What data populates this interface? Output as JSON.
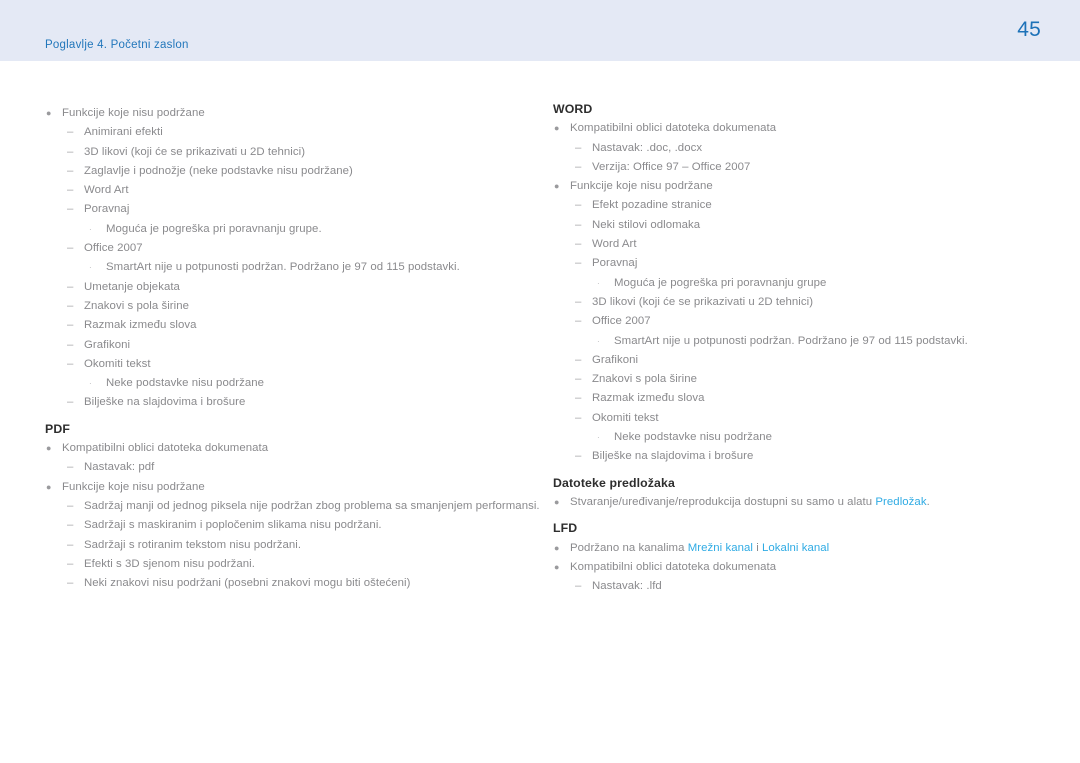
{
  "header": {
    "chapter": "Poglavlje 4. Početni zaslon",
    "page_number": "45",
    "band_color": "#e4e9f5",
    "text_color": "#2277bb"
  },
  "colors": {
    "link": "#2fabe4",
    "body_text": "#8a8a8d",
    "heading_text": "#2e2e2e"
  },
  "left_column": {
    "blocks": [
      {
        "heading": null,
        "items": [
          {
            "level": 1,
            "text": "Funkcije koje nisu podržane"
          },
          {
            "level": 2,
            "text": "Animirani efekti"
          },
          {
            "level": 2,
            "text": "3D likovi (koji će se prikazivati u 2D tehnici)"
          },
          {
            "level": 2,
            "text": "Zaglavlje i podnožje (neke podstavke nisu podržane)"
          },
          {
            "level": 2,
            "text": "Word Art"
          },
          {
            "level": 2,
            "text": "Poravnaj"
          },
          {
            "level": 3,
            "text": "Moguća je pogreška pri poravnanju grupe."
          },
          {
            "level": 2,
            "text": "Office 2007"
          },
          {
            "level": 3,
            "text": "SmartArt nije u potpunosti podržan. Podržano je 97 od 115 podstavki."
          },
          {
            "level": 2,
            "text": "Umetanje objekata"
          },
          {
            "level": 2,
            "text": "Znakovi s pola širine"
          },
          {
            "level": 2,
            "text": "Razmak između slova"
          },
          {
            "level": 2,
            "text": "Grafikoni"
          },
          {
            "level": 2,
            "text": "Okomiti tekst"
          },
          {
            "level": 3,
            "text": "Neke podstavke nisu podržane"
          },
          {
            "level": 2,
            "text": "Bilješke na slajdovima i brošure"
          }
        ]
      },
      {
        "heading": "PDF",
        "items": [
          {
            "level": 1,
            "text": "Kompatibilni oblici datoteka dokumenata"
          },
          {
            "level": 2,
            "text": "Nastavak: pdf"
          },
          {
            "level": 1,
            "text": "Funkcije koje nisu podržane"
          },
          {
            "level": 2,
            "text": "Sadržaj manji od jednog piksela nije podržan zbog problema sa smanjenjem performansi."
          },
          {
            "level": 2,
            "text": "Sadržaji s maskiranim i popločenim slikama nisu podržani."
          },
          {
            "level": 2,
            "text": "Sadržaji s rotiranim tekstom nisu podržani."
          },
          {
            "level": 2,
            "text": "Efekti s 3D sjenom nisu podržani."
          },
          {
            "level": 2,
            "text": "Neki znakovi nisu podržani (posebni znakovi mogu biti oštećeni)"
          }
        ]
      }
    ]
  },
  "right_column": {
    "blocks": [
      {
        "heading": "WORD",
        "items": [
          {
            "level": 1,
            "text": "Kompatibilni oblici datoteka dokumenata"
          },
          {
            "level": 2,
            "text": "Nastavak: .doc, .docx"
          },
          {
            "level": 2,
            "text": "Verzija: Office 97 – Office 2007"
          },
          {
            "level": 1,
            "text": "Funkcije koje nisu podržane"
          },
          {
            "level": 2,
            "text": "Efekt pozadine stranice"
          },
          {
            "level": 2,
            "text": "Neki stilovi odlomaka"
          },
          {
            "level": 2,
            "text": "Word Art"
          },
          {
            "level": 2,
            "text": "Poravnaj"
          },
          {
            "level": 3,
            "text": "Moguća je pogreška pri poravnanju grupe"
          },
          {
            "level": 2,
            "text": "3D likovi (koji će se prikazivati u 2D tehnici)"
          },
          {
            "level": 2,
            "text": "Office 2007"
          },
          {
            "level": 3,
            "text": "SmartArt nije u potpunosti podržan. Podržano je 97 od 115 podstavki."
          },
          {
            "level": 2,
            "text": "Grafikoni"
          },
          {
            "level": 2,
            "text": "Znakovi s pola širine"
          },
          {
            "level": 2,
            "text": "Razmak između slova"
          },
          {
            "level": 2,
            "text": "Okomiti tekst"
          },
          {
            "level": 3,
            "text": "Neke podstavke nisu podržane"
          },
          {
            "level": 2,
            "text": "Bilješke na slajdovima i brošure"
          }
        ]
      },
      {
        "heading": "Datoteke predložaka",
        "items": [
          {
            "level": 1,
            "runs": [
              {
                "text": "Stvaranje/uređivanje/reprodukcija dostupni su samo u alatu ",
                "link": false
              },
              {
                "text": "Predložak",
                "link": true
              },
              {
                "text": ".",
                "link": false
              }
            ]
          }
        ]
      },
      {
        "heading": "LFD",
        "items": [
          {
            "level": 1,
            "runs": [
              {
                "text": "Podržano na kanalima ",
                "link": false
              },
              {
                "text": "Mrežni kanal",
                "link": true
              },
              {
                "text": " i ",
                "link": false
              },
              {
                "text": "Lokalni kanal",
                "link": true
              }
            ]
          },
          {
            "level": 1,
            "text": "Kompatibilni oblici datoteka dokumenata"
          },
          {
            "level": 2,
            "text": "Nastavak: .lfd"
          }
        ]
      }
    ]
  },
  "markers": {
    "level1": "●",
    "level2": "–",
    "level3": "·"
  }
}
